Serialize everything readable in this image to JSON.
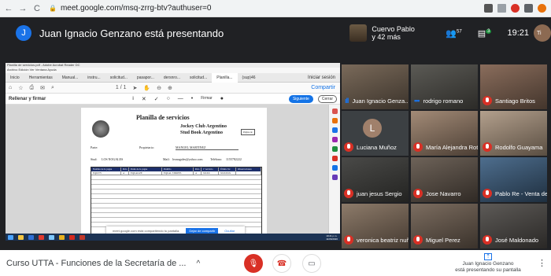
{
  "browser": {
    "url": "meet.google.com/msq-zrrg-btv?authuser=0",
    "back": "←",
    "forward": "→",
    "reload": "C"
  },
  "meet": {
    "presenter_initial": "J",
    "title": "Juan Ignacio Genzano está presentando",
    "other_name": "Cuervo Pablo",
    "others_count": "y 42 más",
    "people_count": "57",
    "chat_count": "3",
    "time": "19:21",
    "self_initial": "Ti"
  },
  "acrobat": {
    "window_title": "Planilla de servicios.pdf - Adobe Acrobat Reader DC",
    "menu": "Archivo  Edición  Ver  Ventana  Ayuda",
    "tabs": [
      "Inicio",
      "Herramientas",
      "Manual...",
      "instru...",
      "solicitud...",
      "pasapor...",
      "dersnro...",
      "solicitud...",
      "Planilla...",
      "(sup)46"
    ],
    "signin": "Iniciar sesión",
    "page": "1 / 1",
    "share_label": "Compartir",
    "fill_sign": "Rellenar y firmar",
    "firmar": "Firmar",
    "siguiente": "Siguiente",
    "cerrar": "Cerrar"
  },
  "document": {
    "heading": "Planilla de servicios",
    "club_line1": "Jockey Club Argentino",
    "club_line2": "Stud Book Argentino",
    "hoja": "Página  de",
    "partes_label": "Parte:",
    "propietario_label": "Propietario:",
    "propietario": "MANUEL MARTINEZ",
    "stud_label": "Stud:",
    "stud": "LOS NOGALES",
    "mail_label": "Mail:",
    "mail": "leonugales@yahoo.com",
    "telefono_label": "Teléfono:",
    "telefono": "1155782222",
    "columns": [
      "Nombre de la yegua",
      "Pelo",
      "Padre de la yegua",
      "Padrillo",
      "Pelo",
      "1ª servicio",
      "Último Sv.",
      "Observaciones"
    ],
    "row1": [
      "EQUITY",
      "A",
      "EQUALIZE",
      "EQUAL STRIPES",
      "A",
      "XXXX",
      "XXXXXX",
      ""
    ]
  },
  "share_banner": {
    "text": "meet.google.com está compartiendo tu pantalla.",
    "stop": "Dejar de compartir",
    "hide": "Ocultar"
  },
  "taskbar": {
    "time": "19:21 p.m.",
    "date": "11/06/2020"
  },
  "participants": [
    {
      "name": "Juan Ignacio Genza...",
      "state": "speaking"
    },
    {
      "name": "rodrigo romano",
      "state": "speaking"
    },
    {
      "name": "Santiago Britos",
      "state": "muted"
    },
    {
      "name": "Luciana Muñoz",
      "state": "muted",
      "initial": "L"
    },
    {
      "name": "María Alejandra Rot...",
      "state": "muted"
    },
    {
      "name": "Rodolfo Guayama",
      "state": "muted"
    },
    {
      "name": "juan jesus Sergio",
      "state": "muted"
    },
    {
      "name": "Jose Navarro",
      "state": "muted"
    },
    {
      "name": "Pablo Re - Venta de...",
      "state": "muted"
    },
    {
      "name": "veronica beatriz nuñ...",
      "state": "muted"
    },
    {
      "name": "Miguel Perez",
      "state": "muted"
    },
    {
      "name": "José Maldonado",
      "state": "muted"
    }
  ],
  "bottom": {
    "meeting_title": "Curso UTTA - Funciones de la Secretaría de ...",
    "chevron": "^",
    "presenter_line1": "Juan Ignacio Genzano",
    "presenter_line2": "está presentando su pantalla",
    "more": "⋮"
  },
  "colors": {
    "accent": "#1a73e8",
    "end_red": "#d93025",
    "meet_bg": "#202124",
    "doc_header": "#1d2f6b"
  }
}
